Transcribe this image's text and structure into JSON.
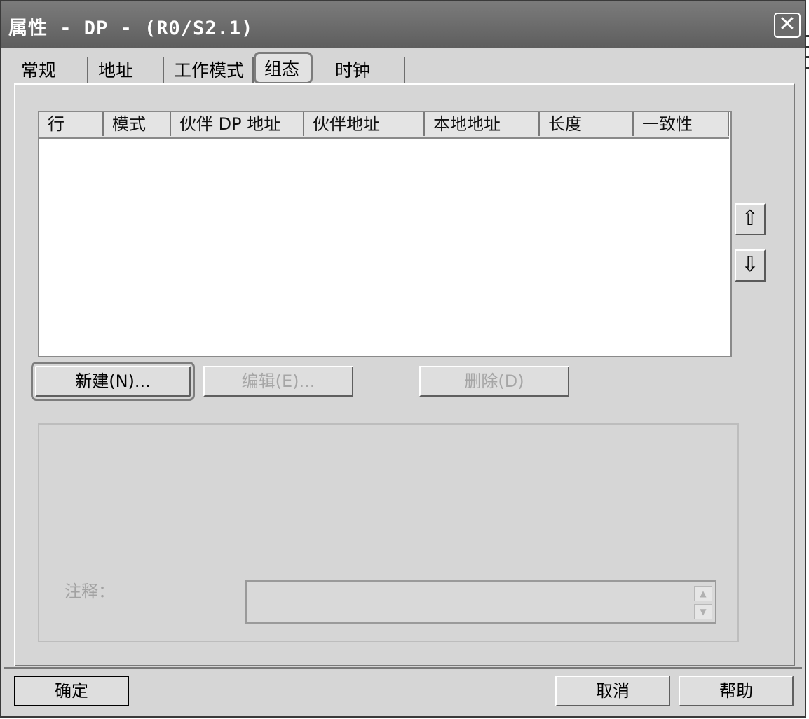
{
  "window": {
    "title": "属性 - DP - (R0/S2.1)",
    "close_label": "✕"
  },
  "tabs": [
    {
      "label": "常规"
    },
    {
      "label": "地址"
    },
    {
      "label": "工作模式"
    },
    {
      "label": "组态"
    },
    {
      "label": "时钟"
    }
  ],
  "active_tab": "组态",
  "table": {
    "columns": [
      "行",
      "模式",
      "伙伴 DP 地址",
      "伙伴地址",
      "本地地址",
      "长度",
      "一致性"
    ],
    "rows": []
  },
  "side_buttons": {
    "up_icon": "up-arrow-icon",
    "up_glyph": "⇧",
    "down_icon": "down-arrow-icon",
    "down_glyph": "⇩"
  },
  "actions": {
    "new_label": "新建(N)...",
    "edit_label": "编辑(E)...",
    "delete_label": "删除(D)"
  },
  "comment": {
    "label": "注释：",
    "value": ""
  },
  "footer": {
    "ok_label": "确定",
    "cancel_label": "取消",
    "help_label": "帮助"
  }
}
